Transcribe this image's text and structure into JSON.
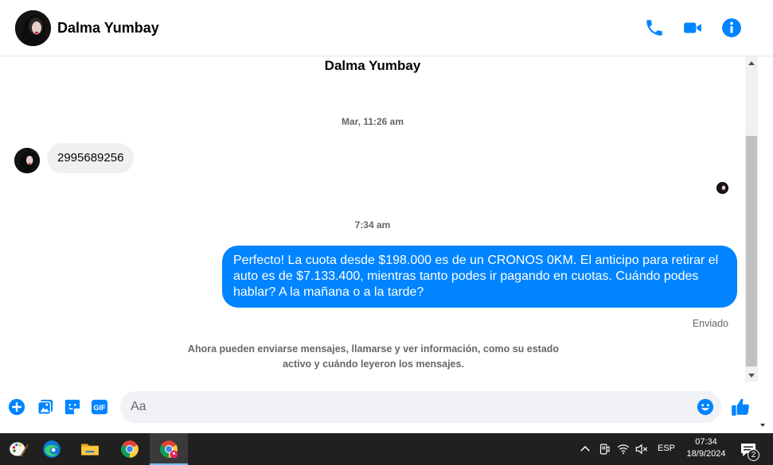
{
  "colors": {
    "accent": "#0084ff",
    "incoming_bubble": "#f0f0f0",
    "muted_text": "#65676b",
    "taskbar": "#202020"
  },
  "header": {
    "contact_name": "Dalma Yumbay",
    "icons": [
      "phone-icon",
      "video-call-icon",
      "info-icon"
    ]
  },
  "conversation": {
    "title": "Dalma Yumbay",
    "timestamp_1": "Mar, 11:26 am",
    "incoming_message": "2995689256",
    "timestamp_2": "7:34 am",
    "outgoing_message": "Perfecto! La cuota desde $198.000 es de un CRONOS 0KM. El anticipo para retirar el auto es de $7.133.400, mientras tanto podes ir pagando en cuotas. Cuándo podes hablar? A la mañana o a la tarde?",
    "sent_status": "Enviado",
    "notice": "Ahora pueden enviarse mensajes, llamarse y ver información, como su estado activo y cuándo leyeron los mensajes."
  },
  "composer": {
    "placeholder": "Aa",
    "value": "",
    "gif_label": "GIF",
    "icons": [
      "plus-icon",
      "photo-icon",
      "sticker-icon",
      "gif-icon",
      "emoji-icon",
      "thumbs-up-icon"
    ]
  },
  "taskbar": {
    "apps": [
      "paint-icon",
      "edge-icon",
      "file-explorer-icon",
      "chrome-icon",
      "chrome-profile-icon"
    ],
    "tray": {
      "language": "ESP",
      "time": "07:34",
      "date": "18/9/2024",
      "notification_count": "2"
    }
  }
}
